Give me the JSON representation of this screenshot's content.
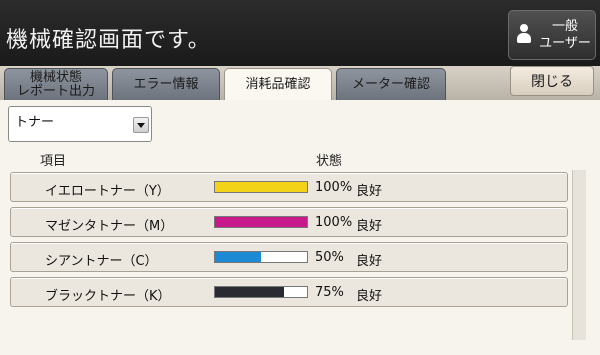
{
  "header": {
    "title": "機械確認画面です。",
    "user_button": "一般\nユーザー"
  },
  "tabs": [
    {
      "label": "機械状態\nレポート出力",
      "active": false
    },
    {
      "label": "エラー情報",
      "active": false
    },
    {
      "label": "消耗品確認",
      "active": true
    },
    {
      "label": "メーター確認",
      "active": false
    }
  ],
  "close_label": "閉じる",
  "dropdown": {
    "selected": "トナー"
  },
  "columns": {
    "item": "項目",
    "status": "状態"
  },
  "rows": [
    {
      "label": "イエロートナー（Y）",
      "percent_text": "100%",
      "state": "良好",
      "level": 1.0,
      "color": "#f3d21a"
    },
    {
      "label": "マゼンタトナー（M）",
      "percent_text": "100%",
      "state": "良好",
      "level": 1.0,
      "color": "#c8198a"
    },
    {
      "label": "シアントナー（C）",
      "percent_text": "50%",
      "state": "良好",
      "level": 0.5,
      "color": "#1d8ad6"
    },
    {
      "label": "ブラックトナー（K）",
      "percent_text": "75%",
      "state": "良好",
      "level": 0.75,
      "color": "#2a2a33"
    }
  ]
}
